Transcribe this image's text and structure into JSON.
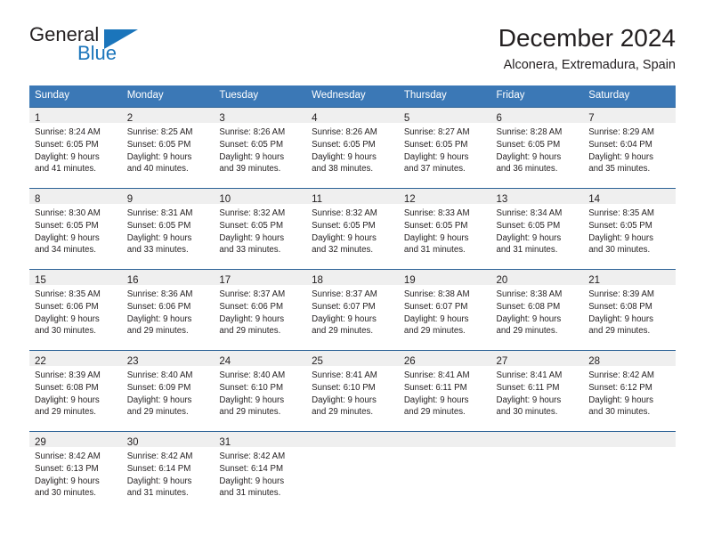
{
  "brand": {
    "name_top": "General",
    "name_bottom": "Blue",
    "accent_color": "#1b75bb"
  },
  "header": {
    "title": "December 2024",
    "location": "Alconera, Extremadura, Spain"
  },
  "calendar": {
    "header_bg": "#3b78b6",
    "daynum_bg": "#efefef",
    "weekdays": [
      "Sunday",
      "Monday",
      "Tuesday",
      "Wednesday",
      "Thursday",
      "Friday",
      "Saturday"
    ],
    "weeks": [
      [
        {
          "day": "1",
          "sunrise": "Sunrise: 8:24 AM",
          "sunset": "Sunset: 6:05 PM",
          "daylight1": "Daylight: 9 hours",
          "daylight2": "and 41 minutes."
        },
        {
          "day": "2",
          "sunrise": "Sunrise: 8:25 AM",
          "sunset": "Sunset: 6:05 PM",
          "daylight1": "Daylight: 9 hours",
          "daylight2": "and 40 minutes."
        },
        {
          "day": "3",
          "sunrise": "Sunrise: 8:26 AM",
          "sunset": "Sunset: 6:05 PM",
          "daylight1": "Daylight: 9 hours",
          "daylight2": "and 39 minutes."
        },
        {
          "day": "4",
          "sunrise": "Sunrise: 8:26 AM",
          "sunset": "Sunset: 6:05 PM",
          "daylight1": "Daylight: 9 hours",
          "daylight2": "and 38 minutes."
        },
        {
          "day": "5",
          "sunrise": "Sunrise: 8:27 AM",
          "sunset": "Sunset: 6:05 PM",
          "daylight1": "Daylight: 9 hours",
          "daylight2": "and 37 minutes."
        },
        {
          "day": "6",
          "sunrise": "Sunrise: 8:28 AM",
          "sunset": "Sunset: 6:05 PM",
          "daylight1": "Daylight: 9 hours",
          "daylight2": "and 36 minutes."
        },
        {
          "day": "7",
          "sunrise": "Sunrise: 8:29 AM",
          "sunset": "Sunset: 6:04 PM",
          "daylight1": "Daylight: 9 hours",
          "daylight2": "and 35 minutes."
        }
      ],
      [
        {
          "day": "8",
          "sunrise": "Sunrise: 8:30 AM",
          "sunset": "Sunset: 6:05 PM",
          "daylight1": "Daylight: 9 hours",
          "daylight2": "and 34 minutes."
        },
        {
          "day": "9",
          "sunrise": "Sunrise: 8:31 AM",
          "sunset": "Sunset: 6:05 PM",
          "daylight1": "Daylight: 9 hours",
          "daylight2": "and 33 minutes."
        },
        {
          "day": "10",
          "sunrise": "Sunrise: 8:32 AM",
          "sunset": "Sunset: 6:05 PM",
          "daylight1": "Daylight: 9 hours",
          "daylight2": "and 33 minutes."
        },
        {
          "day": "11",
          "sunrise": "Sunrise: 8:32 AM",
          "sunset": "Sunset: 6:05 PM",
          "daylight1": "Daylight: 9 hours",
          "daylight2": "and 32 minutes."
        },
        {
          "day": "12",
          "sunrise": "Sunrise: 8:33 AM",
          "sunset": "Sunset: 6:05 PM",
          "daylight1": "Daylight: 9 hours",
          "daylight2": "and 31 minutes."
        },
        {
          "day": "13",
          "sunrise": "Sunrise: 8:34 AM",
          "sunset": "Sunset: 6:05 PM",
          "daylight1": "Daylight: 9 hours",
          "daylight2": "and 31 minutes."
        },
        {
          "day": "14",
          "sunrise": "Sunrise: 8:35 AM",
          "sunset": "Sunset: 6:05 PM",
          "daylight1": "Daylight: 9 hours",
          "daylight2": "and 30 minutes."
        }
      ],
      [
        {
          "day": "15",
          "sunrise": "Sunrise: 8:35 AM",
          "sunset": "Sunset: 6:06 PM",
          "daylight1": "Daylight: 9 hours",
          "daylight2": "and 30 minutes."
        },
        {
          "day": "16",
          "sunrise": "Sunrise: 8:36 AM",
          "sunset": "Sunset: 6:06 PM",
          "daylight1": "Daylight: 9 hours",
          "daylight2": "and 29 minutes."
        },
        {
          "day": "17",
          "sunrise": "Sunrise: 8:37 AM",
          "sunset": "Sunset: 6:06 PM",
          "daylight1": "Daylight: 9 hours",
          "daylight2": "and 29 minutes."
        },
        {
          "day": "18",
          "sunrise": "Sunrise: 8:37 AM",
          "sunset": "Sunset: 6:07 PM",
          "daylight1": "Daylight: 9 hours",
          "daylight2": "and 29 minutes."
        },
        {
          "day": "19",
          "sunrise": "Sunrise: 8:38 AM",
          "sunset": "Sunset: 6:07 PM",
          "daylight1": "Daylight: 9 hours",
          "daylight2": "and 29 minutes."
        },
        {
          "day": "20",
          "sunrise": "Sunrise: 8:38 AM",
          "sunset": "Sunset: 6:08 PM",
          "daylight1": "Daylight: 9 hours",
          "daylight2": "and 29 minutes."
        },
        {
          "day": "21",
          "sunrise": "Sunrise: 8:39 AM",
          "sunset": "Sunset: 6:08 PM",
          "daylight1": "Daylight: 9 hours",
          "daylight2": "and 29 minutes."
        }
      ],
      [
        {
          "day": "22",
          "sunrise": "Sunrise: 8:39 AM",
          "sunset": "Sunset: 6:08 PM",
          "daylight1": "Daylight: 9 hours",
          "daylight2": "and 29 minutes."
        },
        {
          "day": "23",
          "sunrise": "Sunrise: 8:40 AM",
          "sunset": "Sunset: 6:09 PM",
          "daylight1": "Daylight: 9 hours",
          "daylight2": "and 29 minutes."
        },
        {
          "day": "24",
          "sunrise": "Sunrise: 8:40 AM",
          "sunset": "Sunset: 6:10 PM",
          "daylight1": "Daylight: 9 hours",
          "daylight2": "and 29 minutes."
        },
        {
          "day": "25",
          "sunrise": "Sunrise: 8:41 AM",
          "sunset": "Sunset: 6:10 PM",
          "daylight1": "Daylight: 9 hours",
          "daylight2": "and 29 minutes."
        },
        {
          "day": "26",
          "sunrise": "Sunrise: 8:41 AM",
          "sunset": "Sunset: 6:11 PM",
          "daylight1": "Daylight: 9 hours",
          "daylight2": "and 29 minutes."
        },
        {
          "day": "27",
          "sunrise": "Sunrise: 8:41 AM",
          "sunset": "Sunset: 6:11 PM",
          "daylight1": "Daylight: 9 hours",
          "daylight2": "and 30 minutes."
        },
        {
          "day": "28",
          "sunrise": "Sunrise: 8:42 AM",
          "sunset": "Sunset: 6:12 PM",
          "daylight1": "Daylight: 9 hours",
          "daylight2": "and 30 minutes."
        }
      ],
      [
        {
          "day": "29",
          "sunrise": "Sunrise: 8:42 AM",
          "sunset": "Sunset: 6:13 PM",
          "daylight1": "Daylight: 9 hours",
          "daylight2": "and 30 minutes."
        },
        {
          "day": "30",
          "sunrise": "Sunrise: 8:42 AM",
          "sunset": "Sunset: 6:14 PM",
          "daylight1": "Daylight: 9 hours",
          "daylight2": "and 31 minutes."
        },
        {
          "day": "31",
          "sunrise": "Sunrise: 8:42 AM",
          "sunset": "Sunset: 6:14 PM",
          "daylight1": "Daylight: 9 hours",
          "daylight2": "and 31 minutes."
        },
        {
          "day": "",
          "sunrise": "",
          "sunset": "",
          "daylight1": "",
          "daylight2": ""
        },
        {
          "day": "",
          "sunrise": "",
          "sunset": "",
          "daylight1": "",
          "daylight2": ""
        },
        {
          "day": "",
          "sunrise": "",
          "sunset": "",
          "daylight1": "",
          "daylight2": ""
        },
        {
          "day": "",
          "sunrise": "",
          "sunset": "",
          "daylight1": "",
          "daylight2": ""
        }
      ]
    ]
  }
}
